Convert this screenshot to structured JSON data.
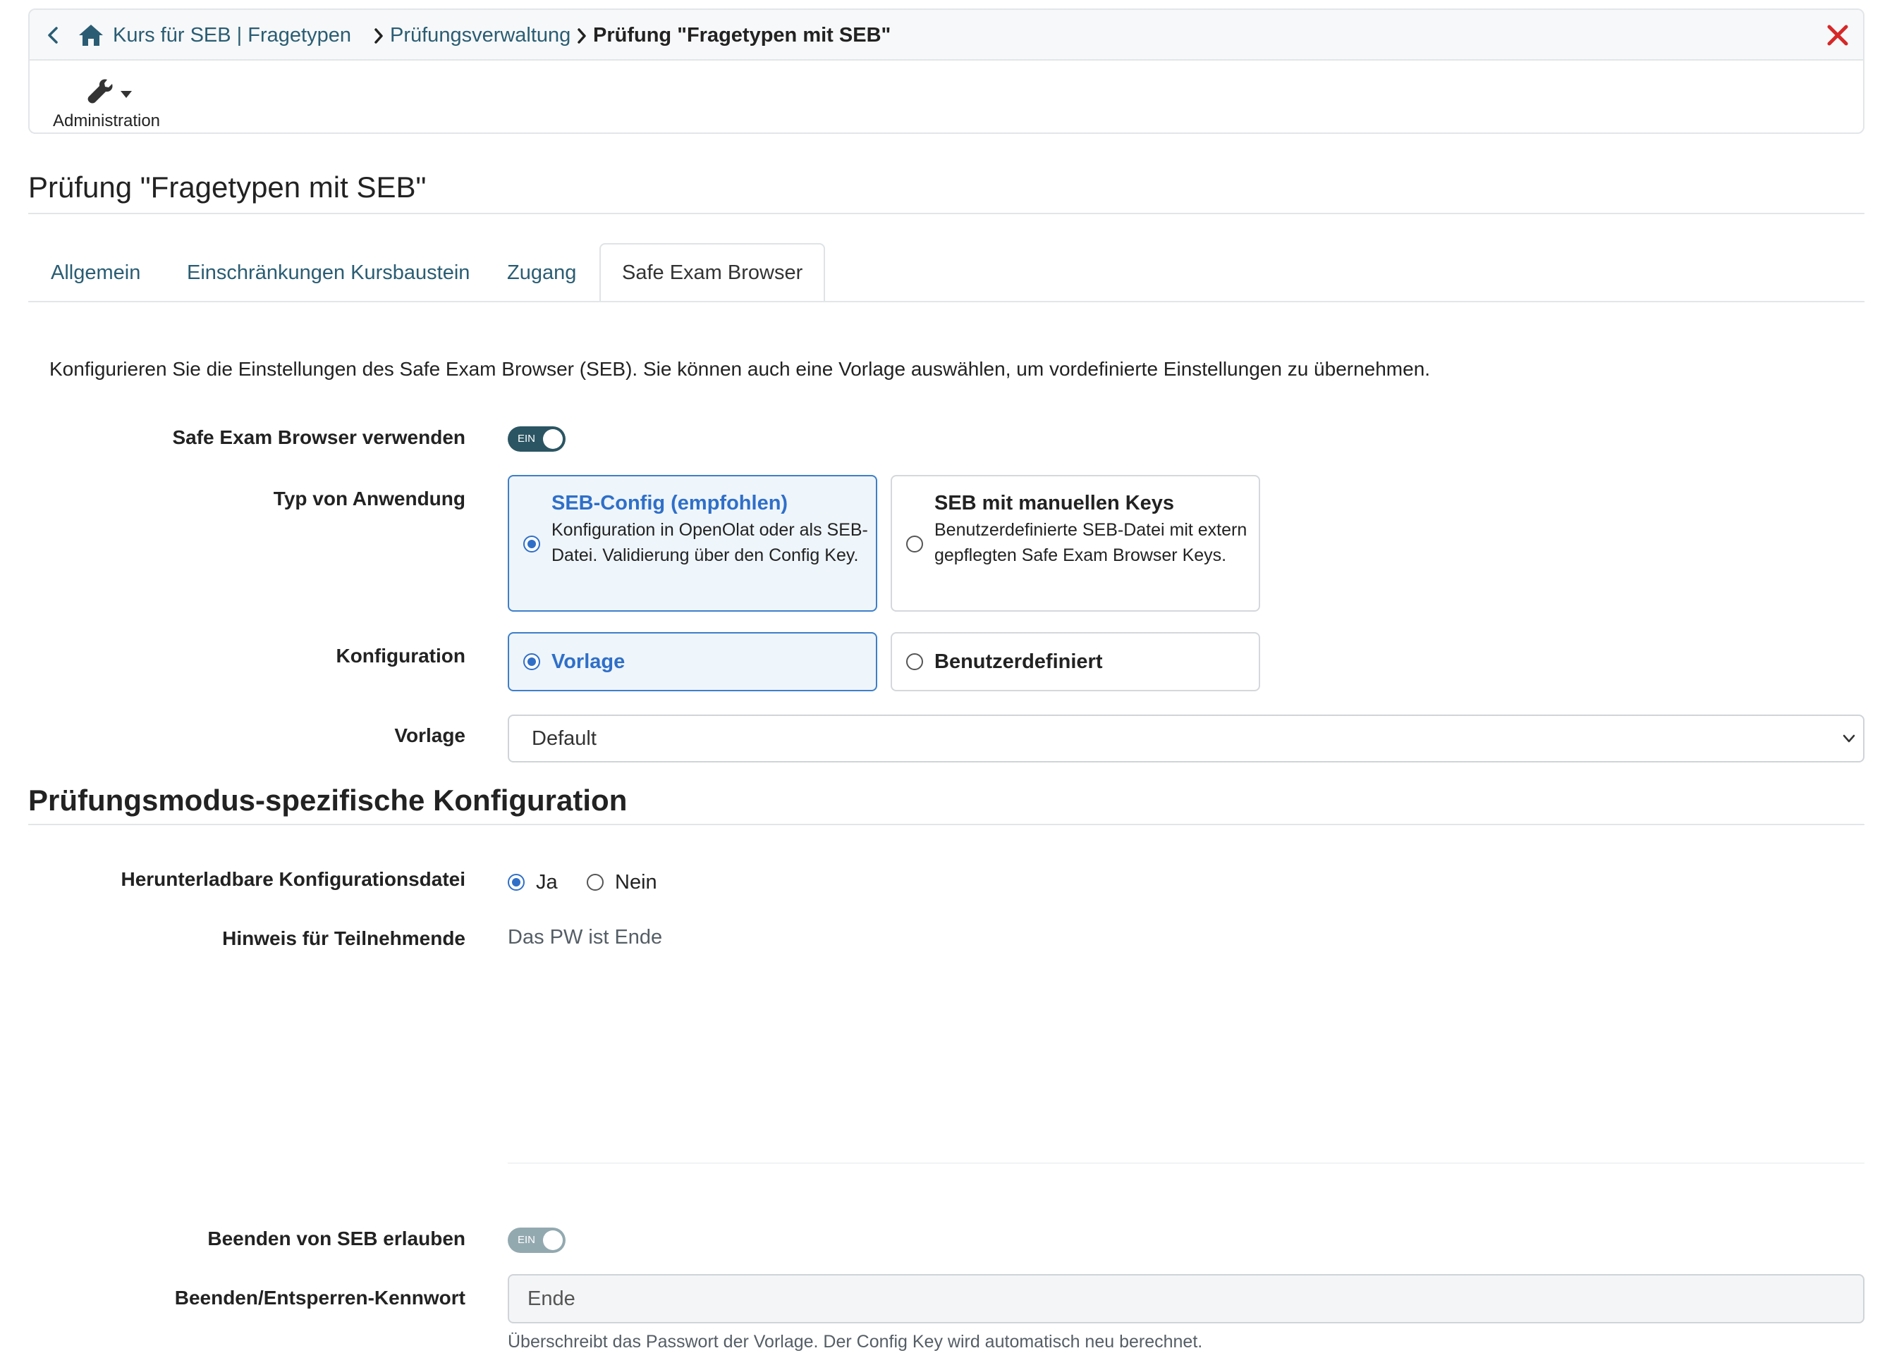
{
  "breadcrumb": {
    "items": [
      "Kurs für SEB | Fragetypen",
      "Prüfungsverwaltung"
    ],
    "current": "Prüfung \"Fragetypen mit SEB\""
  },
  "toolbar": {
    "admin_label": "Administration"
  },
  "page": {
    "title": "Prüfung \"Fragetypen mit SEB\""
  },
  "tabs": [
    {
      "label": "Allgemein"
    },
    {
      "label": "Einschränkungen Kursbaustein"
    },
    {
      "label": "Zugang"
    },
    {
      "label": "Safe Exam Browser",
      "active": true
    }
  ],
  "intro": "Konfigurieren Sie die Einstellungen des Safe Exam Browser (SEB). Sie können auch eine Vorlage auswählen, um vordefinierte Einstellungen zu übernehmen.",
  "form": {
    "use_seb": {
      "label": "Safe Exam Browser verwenden",
      "state": "EIN"
    },
    "app_type": {
      "label": "Typ von Anwendung",
      "options": [
        {
          "title": "SEB-Config (empfohlen)",
          "desc": "Konfiguration in OpenOlat oder als SEB-Datei. Validierung über den Config Key.",
          "selected": true
        },
        {
          "title": "SEB mit manuellen Keys",
          "desc": "Benutzerdefinierte SEB-Datei mit extern gepflegten Safe Exam Browser Keys.",
          "selected": false
        }
      ]
    },
    "config": {
      "label": "Konfiguration",
      "options": [
        {
          "title": "Vorlage",
          "selected": true
        },
        {
          "title": "Benutzerdefiniert",
          "selected": false
        }
      ]
    },
    "template": {
      "label": "Vorlage",
      "value": "Default"
    }
  },
  "section2": {
    "title": "Prüfungsmodus-spezifische Konfiguration",
    "download": {
      "label": "Herunterladbare Konfigurationsdatei",
      "yes": "Ja",
      "no": "Nein",
      "selected": "Ja"
    },
    "hint": {
      "label": "Hinweis für Teilnehmende",
      "value": "Das PW ist Ende"
    },
    "allow_quit": {
      "label": "Beenden von SEB erlauben",
      "state": "EIN"
    },
    "password": {
      "label": "Beenden/Entsperren-Kennwort",
      "value": "Ende",
      "help": "Überschreibt das Passwort der Vorlage. Der Config Key wird automatisch neu berechnet."
    }
  },
  "colors": {
    "link": "#2a5d73",
    "accent": "#2f6fc8",
    "toggle_on": "#2b5563",
    "close": "#d62828",
    "selected_bg": "#eef5fb"
  },
  "icons": [
    "chevron-left-icon",
    "home-icon",
    "chevron-right-icon",
    "close-icon",
    "wrench-icon",
    "caret-down-icon",
    "chevron-down-icon"
  ]
}
